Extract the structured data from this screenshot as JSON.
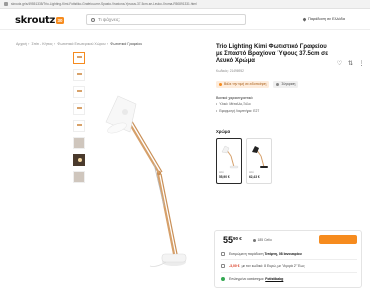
{
  "browser": {
    "url": "skroutz.gr/s/49551335/Trio-Lighting-Kimi-Fotistiko-Grafeiou-me-Spasto-Vraxiona-Ypsous-37-5cm-se-Leuko-Xroma-R50891331.html"
  },
  "header": {
    "logo_text": "skroutz",
    "logo_badge": "30",
    "search_placeholder": "Τι ψάχνεις;",
    "location_text": "Παράδοση σε Ελλάδα"
  },
  "breadcrumbs": [
    "Αρχική",
    "Σπίτι - Κήπος",
    "Φωτιστικά Εσωτερικού Χώρου",
    "Φωτιστικά Γραφείου"
  ],
  "product": {
    "title": "Trio Lighting Kimi Φωτιστικό Γραφείου με Σπαστό Βραχίονα Ύψους 37.5cm σε Λευκό Χρώμα",
    "code": "Κωδικός: 21496952",
    "chips": [
      "Βάλε την τιμή σε ειδοποίηση",
      "Σύγκριση"
    ],
    "features_header": "Βασικά χαρακτηριστικά",
    "features": [
      "Υλικό: Μέταλλο,Ξύλο",
      "Εφαρμογή Λαμπτήρα: E27"
    ],
    "color_header": "Χρώμα",
    "swatches": [
      {
        "from": "από",
        "price": "55,90 €"
      },
      {
        "from": "από",
        "price": "62,43 €"
      }
    ]
  },
  "buybox": {
    "price_int": "55",
    "price_dec": "90 €",
    "shop": "185 Celio",
    "delivery_prefix": "Εκτιμώμενη παράδοση",
    "delivery_date": "Τετάρτη, 08 Ιανουαρίου",
    "discount": "-3,00 €",
    "discount_text": "με τον κωδικό: 8 Ευρώ, με \"Αγορά 2\" Έως",
    "pickup_prefix": "Επιλεγμένο κατάστημα:",
    "pickup_link": "Fotistikabg"
  },
  "colors": {
    "accent": "#f68b1e",
    "discount": "#d8341b"
  }
}
